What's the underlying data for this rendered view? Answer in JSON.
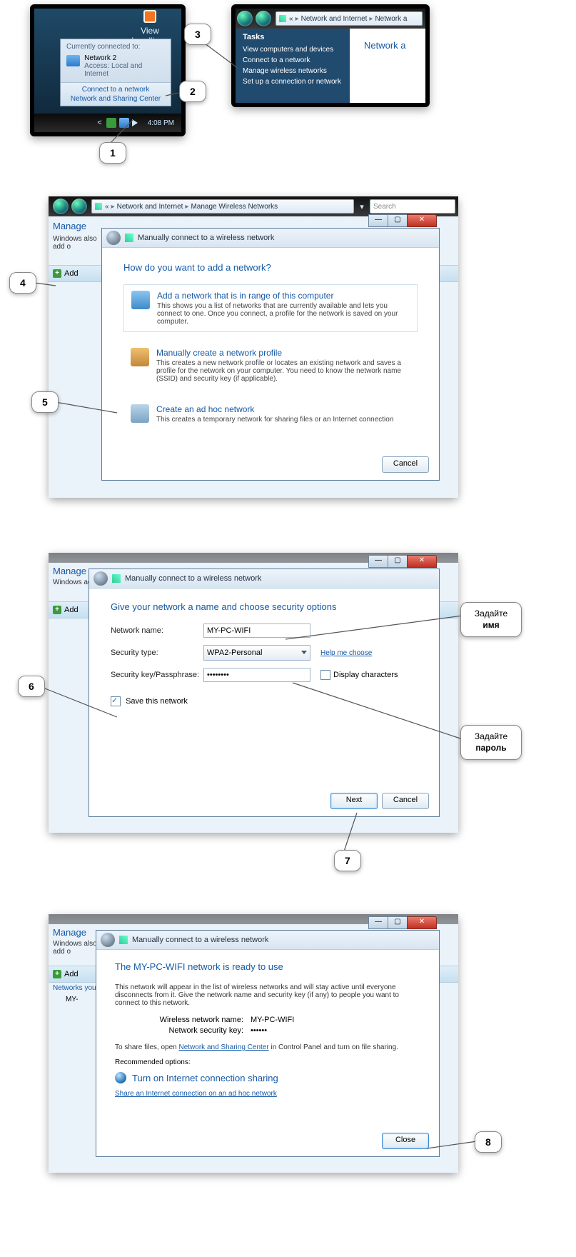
{
  "callouts": {
    "c1": "1",
    "c2": "2",
    "c3": "3",
    "c4": "4",
    "c5": "5",
    "c6": "6",
    "c7": "7",
    "c8": "8",
    "name_hint_l1": "Задайте",
    "name_hint_l2": "имя",
    "pass_hint_l1": "Задайте",
    "pass_hint_l2": "пароль"
  },
  "s1": {
    "headlines": "View headlines",
    "connected": "Currently connected to:",
    "network_name": "Network  2",
    "access": "Access:  Local and Internet",
    "link_connect": "Connect to a network",
    "link_nsc": "Network and Sharing Center",
    "time": "4:08 PM"
  },
  "s2": {
    "crumb1": "Network and Internet",
    "crumb2": "Network a",
    "tasks_title": "Tasks",
    "t1": "View computers and devices",
    "t2": "Connect to a network",
    "t3": "Manage wireless networks",
    "t4": "Set up a connection or network",
    "right_heading": "Network a"
  },
  "s3": {
    "crumb1": "Network and Internet",
    "crumb2": "Manage Wireless Networks",
    "search_placeholder": "Search",
    "manage": "Manage",
    "side": "Windows also add o",
    "add": "Add",
    "wiz_title": "Manually connect to a wireless network",
    "wiz_head": "How do you want to add a network?",
    "o1_t": "Add a network that is in range of this computer",
    "o1_d": "This shows you a list of networks that are currently available and lets you connect to one. Once you connect, a profile for the network is saved on your computer.",
    "o2_t": "Manually create a network profile",
    "o2_d": "This creates a new network profile or locates an existing network and saves a profile for the network on your computer. You need to know the network name (SSID) and security key (if applicable).",
    "o3_t": "Create an ad hoc network",
    "o3_d": "This creates a temporary network for sharing files or an Internet connection",
    "cancel": "Cancel"
  },
  "s4": {
    "wiz_title": "Manually connect to a wireless network",
    "wiz_head": "Give your network a name and choose security options",
    "lbl_name": "Network name:",
    "val_name": "MY-PC-WIFI",
    "lbl_sec": "Security type:",
    "val_sec": "WPA2-Personal",
    "help": "Help me choose",
    "lbl_key": "Security key/Passphrase:",
    "val_key": "••••••••",
    "disp": "Display characters",
    "save": "Save this network",
    "next": "Next",
    "cancel": "Cancel",
    "manage": "Manage",
    "side": "Windows add o",
    "add": "Add"
  },
  "s5": {
    "wiz_title": "Manually connect to a wireless network",
    "ready": "The MY-PC-WIFI network is ready to use",
    "desc": "This network will appear in the list of wireless networks and will stay active until everyone disconnects from it. Give the network name and security key (if any) to people you want to connect to this network.",
    "k1": "Wireless network name:",
    "v1": "MY-PC-WIFI",
    "k2": "Network security key:",
    "v2": "••••••",
    "share_pre": "To share files, open ",
    "nsc": "Network and Sharing Center",
    "share_post": " in Control Panel and turn on file sharing.",
    "rec": "Recommended options:",
    "turn_on": "Turn on Internet connection sharing",
    "share_link": "Share an Internet connection on an ad hoc network",
    "close": "Close",
    "manage": "Manage",
    "side": "Windows also add o",
    "add": "Add",
    "networks_you": "Networks you",
    "my": "MY-"
  }
}
